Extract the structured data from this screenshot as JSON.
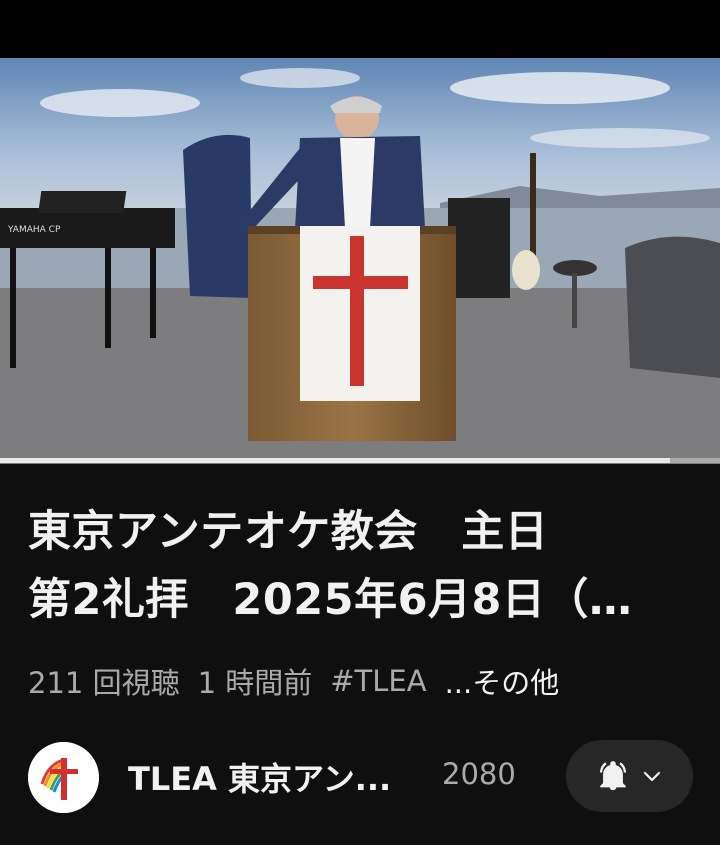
{
  "video": {
    "title_line1": "東京アンテオケ教会　主日",
    "title_line2": "第2礼拝　2025年6月8日（…",
    "views": "211 回視聴",
    "time_ago": "1 時間前",
    "hashtag": "#TLEA",
    "more_label": "...その他",
    "progress_fraction": 0.93,
    "keyboard_brand": "YAMAHA CP"
  },
  "channel": {
    "name": "TLEA 東京アン...",
    "subscriber_count": "2080",
    "avatar_icon": "cross-logo-icon",
    "subscribe_state_icon": "bell-icon",
    "dropdown_icon": "chevron-down-icon"
  },
  "colors": {
    "background": "#0f0f0f",
    "pill": "#272727",
    "primary_text": "#f1f1f1",
    "secondary_text": "#aaaaaa"
  }
}
